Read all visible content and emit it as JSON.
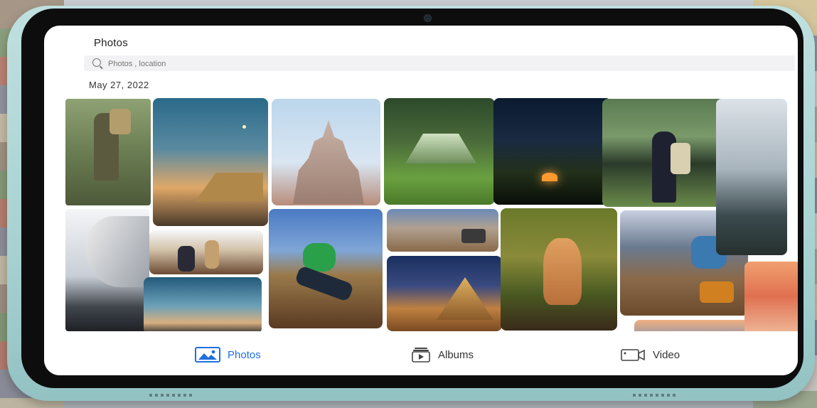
{
  "app": {
    "title": "Photos"
  },
  "search": {
    "placeholder": "Photos , location"
  },
  "gallery": {
    "date_header": "May 27, 2022"
  },
  "tabs": [
    {
      "label": "Photos",
      "icon": "photo-icon",
      "active": true
    },
    {
      "label": "Albums",
      "icon": "album-icon",
      "active": false
    },
    {
      "label": "Video",
      "icon": "video-camera-icon",
      "active": false
    }
  ],
  "colors": {
    "accent": "#1f6fe0",
    "device_body": "#a8d2d2"
  }
}
